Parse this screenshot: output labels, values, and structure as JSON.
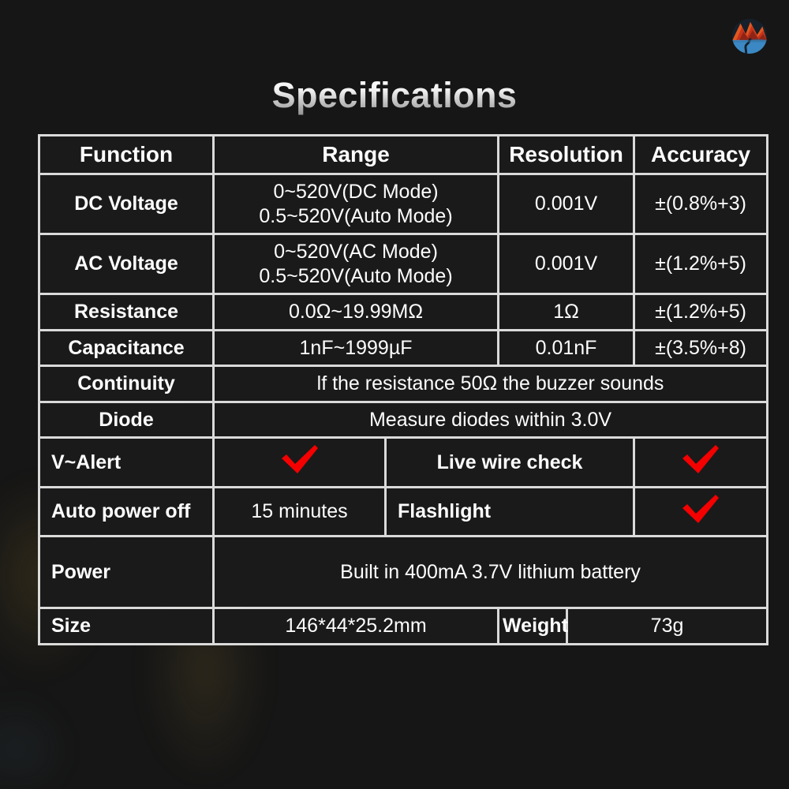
{
  "page": {
    "title": "Specifications",
    "logo_icon": "mountain-river-circle-logo",
    "check_icon": "red-checkmark-icon",
    "accent_check_color": "#f40000",
    "background_color": "#161616",
    "cell_color": "#1a1a1a",
    "border_color": "#ebebeb"
  },
  "table": {
    "headers": [
      "Function",
      "Range",
      "Resolution",
      "Accuracy"
    ],
    "rows": [
      {
        "function": "DC Voltage",
        "range_line1": "0~520V(DC Mode)",
        "range_line2": "0.5~520V(Auto Mode)",
        "resolution": "0.001V",
        "accuracy": "±(0.8%+3)"
      },
      {
        "function": "AC Voltage",
        "range_line1": "0~520V(AC Mode)",
        "range_line2": "0.5~520V(Auto Mode)",
        "resolution": "0.001V",
        "accuracy": "±(1.2%+5)"
      },
      {
        "function": "Resistance",
        "range_line1": "0.0Ω~19.99MΩ",
        "resolution": "1Ω",
        "accuracy": "±(1.2%+5)"
      },
      {
        "function": "Capacitance",
        "range_line1": "1nF~1999µF",
        "resolution": "0.01nF",
        "accuracy": "±(3.5%+8)"
      }
    ],
    "continuity": {
      "function": "Continuity",
      "description": "lf the resistance 50Ω the buzzer sounds"
    },
    "diode": {
      "function": "Diode",
      "description": "Measure diodes within 3.0V"
    },
    "feature_row_1": {
      "left_label": "V~Alert",
      "left_value": "check",
      "right_label": "Live wire check",
      "right_value": "check"
    },
    "feature_row_2": {
      "left_label": "Auto power off",
      "left_value": "15 minutes",
      "right_label": "Flashlight",
      "right_value": "check"
    },
    "power": {
      "label": "Power",
      "value": "Built in 400mA 3.7V lithium battery"
    },
    "size_weight": {
      "size_label": "Size",
      "size_value": "146*44*25.2mm",
      "weight_label": "Weight",
      "weight_value": "73g"
    }
  }
}
